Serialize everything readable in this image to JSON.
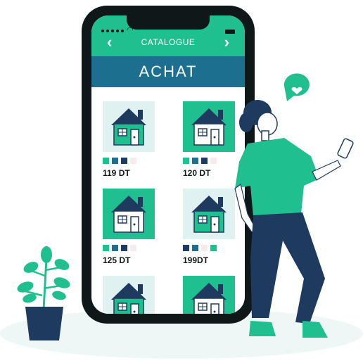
{
  "app": {
    "header_title": "CATALOGUE",
    "banner_title": "ACHAT"
  },
  "colors": {
    "primary_green": "#20bf8f",
    "banner_blue": "#1c6f8f",
    "navy": "#1e3a5f",
    "tile_light": "#dff1f1",
    "swatch_pale": "#f6eceb"
  },
  "products": [
    {
      "price": "119 DT",
      "tile_style": "light",
      "swatches": [
        "#20bf8f",
        "#1c6f8f",
        "#1e3a5f",
        "#f6eceb"
      ]
    },
    {
      "price": "120 DT",
      "tile_style": "green",
      "swatches": [
        "#20bf8f",
        "#1c6f8f",
        "#1e3a5f",
        "#f6eceb"
      ]
    },
    {
      "price": "125 DT",
      "tile_style": "green",
      "swatches": [
        "#20bf8f",
        "#1c6f8f",
        "#1e3a5f",
        "#f6eceb"
      ]
    },
    {
      "price": "199DT",
      "tile_style": "light",
      "swatches": [
        "#1e3a5f",
        "#1c6f8f",
        "#f6eceb",
        "#20bf8f"
      ]
    },
    {
      "price": "",
      "tile_style": "light",
      "swatches": []
    },
    {
      "price": "",
      "tile_style": "green",
      "swatches": []
    }
  ],
  "icons": {
    "back": "chevron-left-icon",
    "forward": "chevron-right-icon",
    "like": "heart-bubble-icon"
  }
}
